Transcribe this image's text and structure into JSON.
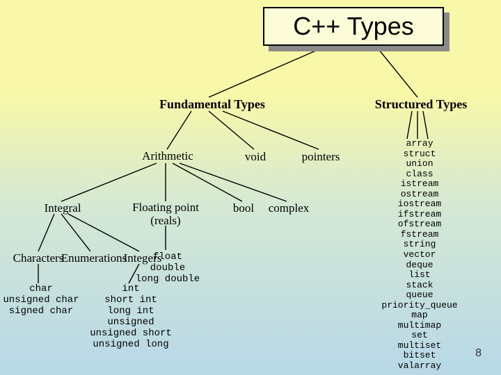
{
  "title": "C++ Types",
  "page_number": "8",
  "nodes": {
    "fundamental": "Fundamental Types",
    "structured": "Structured Types",
    "arithmetic": "Arithmetic",
    "void": "void",
    "pointers": "pointers",
    "integral": "Integral",
    "floating": "Floating point\n(reals)",
    "bool": "bool",
    "complex": "complex",
    "characters": "Characters",
    "enumerations": "Enumerations",
    "integers": "Integers",
    "floating_leaf": "float\ndouble\nlong double",
    "char_leaf": "char\nunsigned char\nsigned char",
    "int_leaf": "int\nshort int\nlong int\nunsigned\nunsigned short\nunsigned long",
    "structured_leaf": "array\nstruct\nunion\nclass\nistream\nostream\niostream\nifstream\nofstream\nfstream\nstring\nvector\ndeque\nlist\nstack\nqueue\npriority_queue\nmap\nmultimap\nset\nmultiset\nbitset\nvalarray"
  }
}
